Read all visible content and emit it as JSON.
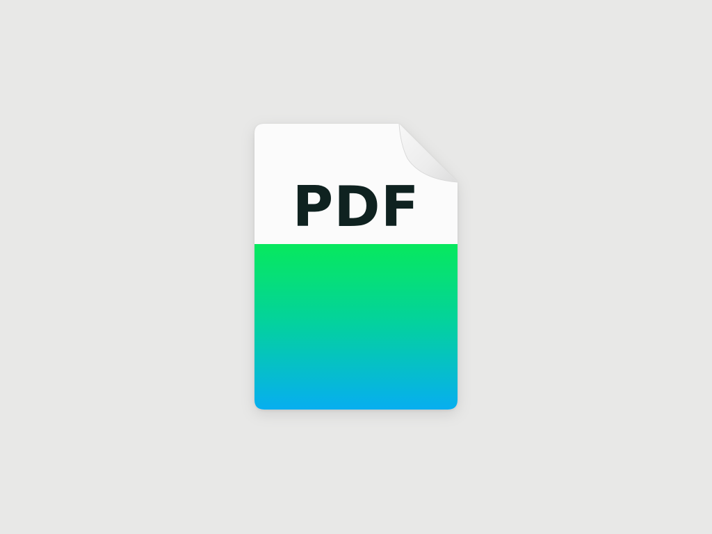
{
  "document": {
    "type_label": "PDF",
    "icon": "pdf-file-icon"
  },
  "colors": {
    "background": "#e8e8e7",
    "page": "#fbfbfb",
    "fold": "#ececec",
    "label": "#0f2220",
    "gradient_top": "#07e85e",
    "gradient_bottom": "#07aef0"
  }
}
